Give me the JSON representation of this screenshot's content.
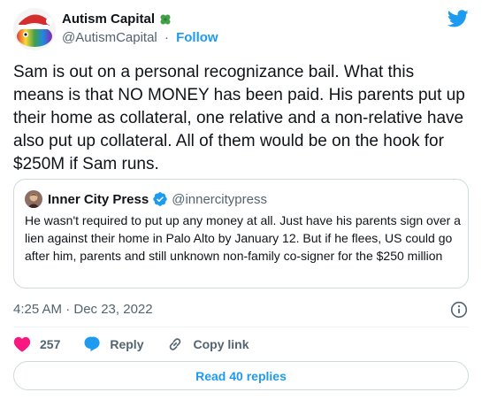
{
  "author": {
    "display_name": "Autism Capital",
    "handle": "@AutismCapital",
    "separator": "·",
    "follow_label": "Follow"
  },
  "tweet": {
    "text": "Sam is out on a personal recognizance bail. What this means is that NO MONEY has been paid. His parents put up their home as collateral, one relative and a non-relative have also put up collateral. All of them would be on the hook for $250M if Sam runs."
  },
  "quote": {
    "display_name": "Inner City Press",
    "handle": "@innercitypress",
    "text": "He wasn't required to put up any money at all. Just have his parents sign over a lien against their home in Palo Alto by January 12. But if he flees, US could go after him, parents and still unknown non-family co-signer for the $250 million"
  },
  "meta": {
    "timestamp": "4:25 AM · Dec 23, 2022"
  },
  "actions": {
    "like_count": "257",
    "reply_label": "Reply",
    "copy_link_label": "Copy link"
  },
  "read_replies_label": "Read 40 replies",
  "colors": {
    "accent": "#1d9bf0",
    "like": "#f91880",
    "text": "#0f1419",
    "muted": "#536471",
    "border": "#cfd9de"
  },
  "icons": [
    "clover-icon",
    "twitter-bird-icon",
    "verified-badge-icon",
    "info-icon",
    "heart-icon",
    "reply-icon",
    "link-icon"
  ]
}
